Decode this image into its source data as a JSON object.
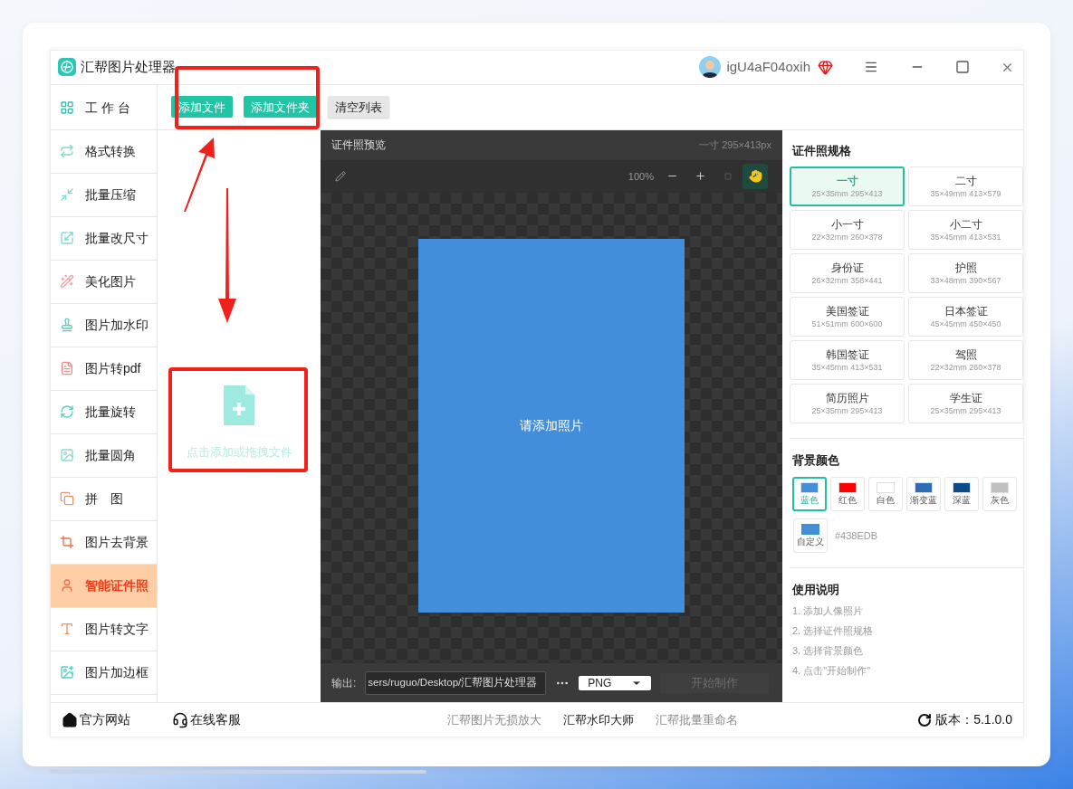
{
  "window": {
    "title": "汇帮图片处理器",
    "user": "igU4aF04oxih"
  },
  "sidebar": {
    "items": [
      {
        "label": "工 作 台",
        "selected": false
      },
      {
        "label": "格式转换",
        "selected": false
      },
      {
        "label": "批量压缩",
        "selected": false
      },
      {
        "label": "批量改尺寸",
        "selected": false
      },
      {
        "label": "美化图片",
        "selected": false
      },
      {
        "label": "图片加水印",
        "selected": false
      },
      {
        "label": "图片转pdf",
        "selected": false
      },
      {
        "label": "批量旋转",
        "selected": false
      },
      {
        "label": "批量圆角",
        "selected": false
      },
      {
        "label": "拼　图",
        "selected": false
      },
      {
        "label": "图片去背景",
        "selected": false
      },
      {
        "label": "智能证件照",
        "selected": true
      },
      {
        "label": "图片转文字",
        "selected": false
      },
      {
        "label": "图片加边框",
        "selected": false
      }
    ]
  },
  "toolbar": [
    {
      "label": "添加文件",
      "kind": "primary"
    },
    {
      "label": "添加文件夹",
      "kind": "primary"
    },
    {
      "label": "清空列表",
      "kind": "secondary"
    }
  ],
  "drop_zone": {
    "text": "点击添加或拖拽文件"
  },
  "preview": {
    "title": "证件照预览",
    "size_info": "一寸 295×413px",
    "zoom": "100%",
    "placeholder_text": "请添加照片",
    "output_label": "输出:",
    "output_path": "sers/ruguo/Desktop/汇帮图片处理器",
    "format": "PNG",
    "start_button": {
      "label": "开始制作",
      "disabled": true
    }
  },
  "spec_panel": {
    "title": "证件照规格",
    "specs": [
      {
        "name": "一寸",
        "dims": "25×35mm 295×413",
        "selected": true
      },
      {
        "name": "二寸",
        "dims": "35×49mm 413×579",
        "selected": false
      },
      {
        "name": "小一寸",
        "dims": "22×32mm 260×378",
        "selected": false
      },
      {
        "name": "小二寸",
        "dims": "35×45mm 413×531",
        "selected": false
      },
      {
        "name": "身份证",
        "dims": "26×32mm 358×441",
        "selected": false
      },
      {
        "name": "护照",
        "dims": "33×48mm 390×567",
        "selected": false
      },
      {
        "name": "美国签证",
        "dims": "51×51mm 600×600",
        "selected": false
      },
      {
        "name": "日本签证",
        "dims": "45×45mm 450×450",
        "selected": false
      },
      {
        "name": "韩国签证",
        "dims": "35×45mm 413×531",
        "selected": false
      },
      {
        "name": "驾照",
        "dims": "22×32mm 260×378",
        "selected": false
      },
      {
        "name": "简历照片",
        "dims": "25×35mm 295×413",
        "selected": false
      },
      {
        "name": "学生证",
        "dims": "25×35mm 295×413",
        "selected": false
      }
    ]
  },
  "background_color": {
    "title": "背景颜色",
    "options": [
      {
        "label": "蓝色",
        "color": "#438edb",
        "selected": true
      },
      {
        "label": "红色",
        "color": "#ff0000",
        "selected": false
      },
      {
        "label": "白色",
        "color": "#ffffff",
        "selected": false
      },
      {
        "label": "渐变蓝",
        "color": "#2e6db4",
        "selected": false
      },
      {
        "label": "深蓝",
        "color": "#0d4a8a",
        "selected": false
      },
      {
        "label": "灰色",
        "color": "#c0c0c0",
        "selected": false
      }
    ],
    "custom": {
      "label": "自定义",
      "color": "#438edb",
      "value": "#438EDB"
    }
  },
  "instructions": {
    "title": "使用说明",
    "steps": [
      "1. 添加人像照片",
      "2. 选择证件照规格",
      "3. 选择背景颜色",
      "4. 点击\"开始制作\""
    ]
  },
  "footer": {
    "left_links": [
      "官方网站",
      "在线客服"
    ],
    "products": [
      {
        "label": "汇帮图片无损放大",
        "emphasized": false
      },
      {
        "label": "汇帮水印大师",
        "emphasized": true
      },
      {
        "label": "汇帮批量重命名",
        "emphasized": false
      }
    ],
    "version": "版本：5.1.0.0"
  }
}
